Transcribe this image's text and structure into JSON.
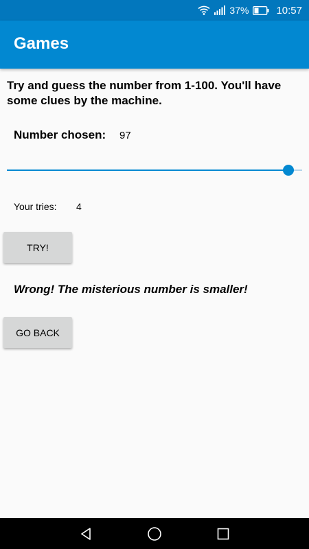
{
  "status_bar": {
    "battery_percent": "37%",
    "time": "10:57",
    "wifi_icon": "wifi-icon",
    "signal_icon": "signal-icon",
    "battery_icon": "battery-icon"
  },
  "app_bar": {
    "title": "Games",
    "color": "#0288d1"
  },
  "content": {
    "intro": "Try and guess the number from 1-100. You'll have some clues by the machine.",
    "chosen_label": "Number chosen:",
    "chosen_value": "97",
    "slider": {
      "min": 1,
      "max": 100,
      "value": 97,
      "accent": "#0288d1"
    },
    "tries_label": "Your tries:",
    "tries_value": "4",
    "try_button": "TRY!",
    "result": "Wrong! The misterious number is smaller!",
    "back_button": "GO BACK"
  },
  "nav_bar": {
    "back_icon": "back-triangle-icon",
    "home_icon": "home-circle-icon",
    "recent_icon": "recent-square-icon"
  }
}
